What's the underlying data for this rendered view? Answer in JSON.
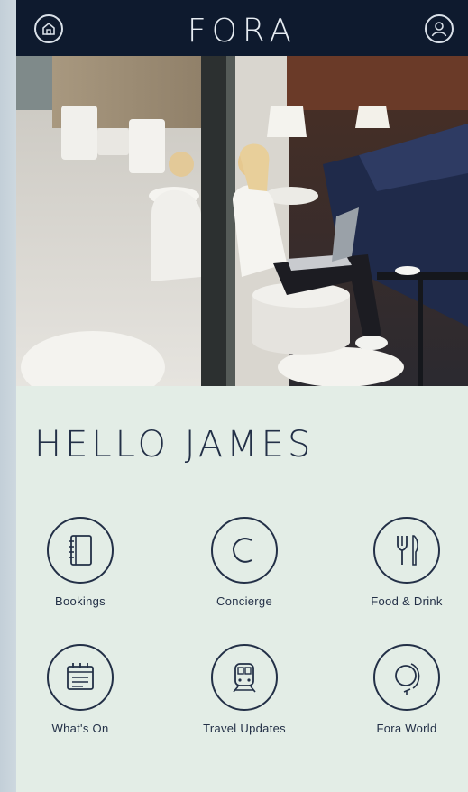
{
  "app": {
    "brand": "FORA",
    "greeting": "HELLO JAMES"
  },
  "header": {
    "left_icon": "home-icon",
    "right_icon": "account-icon"
  },
  "hero": {
    "description_icon": "hero-photo"
  },
  "menu": [
    {
      "label": "Bookings",
      "icon": "notebook-icon"
    },
    {
      "label": "Concierge",
      "icon": "concierge-c-icon"
    },
    {
      "label": "Food & Drink",
      "icon": "fork-knife-icon"
    },
    {
      "label": "What's On",
      "icon": "calendar-icon"
    },
    {
      "label": "Travel Updates",
      "icon": "train-icon"
    },
    {
      "label": "Fora World",
      "icon": "globe-icon"
    }
  ],
  "colors": {
    "navy": "#0e1a2e",
    "ink": "#233047",
    "background": "#e3ede6"
  }
}
